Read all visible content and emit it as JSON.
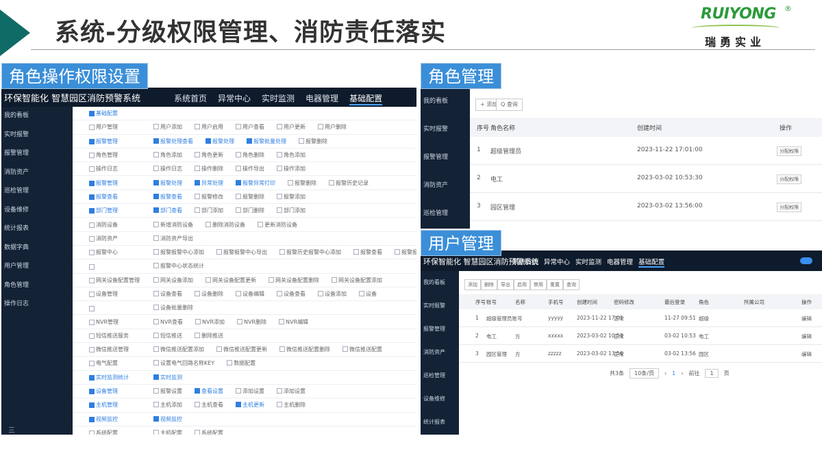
{
  "slide": {
    "title": "系统-分级权限管理、消防责任落实",
    "logo_text": "RUIYONG",
    "logo_reg": "®",
    "logo_cn": "瑞勇实业"
  },
  "labels": {
    "role_perm": "角色操作权限设置",
    "role_mgmt": "角色管理",
    "user_mgmt": "用户管理"
  },
  "p1": {
    "brand": "环保智能化 智慧园区消防预警系统",
    "nav": [
      "系统首页",
      "异常中心",
      "实时监测",
      "电器管理",
      "基础配置"
    ],
    "side": [
      "我的看板",
      "实时报警",
      "报警管理",
      "消防资产",
      "巡检管理",
      "设备维修",
      "统计报表",
      "数据字典",
      "用户管理",
      "角色管理",
      "操作日志"
    ],
    "side_foot": "三",
    "rows": [
      {
        "head": "基础配置",
        "items": [],
        "blue": true
      },
      {
        "head": "用户管理",
        "items": [
          "用户添加",
          "用户启用",
          "用户查看",
          "用户更新",
          "用户删除"
        ]
      },
      {
        "head": "报警管理",
        "items": [
          "报警处理查看",
          "报警处理",
          "报警批量处理",
          "报警删除"
        ],
        "blue": true,
        "on": [
          0,
          1,
          2
        ]
      },
      {
        "head": "角色管理",
        "items": [
          "角色添加",
          "角色更新",
          "角色删除",
          "角色添加"
        ]
      },
      {
        "head": "操作日志",
        "items": [
          "操作日志",
          "操作删除",
          "操作导出",
          "操作添加"
        ]
      },
      {
        "head": "报警管理",
        "items": [
          "报警处理",
          "异常处理",
          "报警异常打印",
          "报警删除",
          "报警历史记录"
        ],
        "blue": true,
        "on": [
          0,
          1,
          2
        ]
      },
      {
        "head": "报警查看",
        "items": [
          "报警查看",
          "报警修改",
          "报警删除",
          "报警添加"
        ],
        "blue": true,
        "on": [
          0
        ]
      },
      {
        "head": "部门管理",
        "items": [
          "部门查看",
          "部门添加",
          "部门删除",
          "部门添加"
        ],
        "blue": true,
        "on": [
          0
        ]
      },
      {
        "head": "消防设备",
        "items": [
          "新增消防设备",
          "删除消防设备",
          "更新消防设备"
        ]
      },
      {
        "head": "消防资产",
        "items": [
          "消防资产导出"
        ]
      },
      {
        "head": "报警中心",
        "items": [
          "报警报警中心添加",
          "报警报警中心导出",
          "报警历史报警中心添加",
          "报警查看",
          "报警报警"
        ]
      },
      {
        "head": "",
        "items": [
          "报警中心状态统计"
        ]
      },
      {
        "head": "网关设备配置管理",
        "items": [
          "网关设备添加",
          "网关设备配置更新",
          "网关设备配置删除",
          "网关设备配置添加"
        ]
      },
      {
        "head": "设备管理",
        "items": [
          "设备查看",
          "设备删除",
          "设备编辑",
          "设备查看",
          "设备添加",
          "设备"
        ]
      },
      {
        "head": "",
        "items": [
          "设备批量删除"
        ]
      },
      {
        "head": "NVR管理",
        "items": [
          "NVR查看",
          "NVR添加",
          "NVR删除",
          "NVR编辑"
        ]
      },
      {
        "head": "短信推送服务",
        "items": [
          "短信推送",
          "删除推送"
        ]
      },
      {
        "head": "微信推送管理",
        "items": [
          "微信推送配置添加",
          "微信推送配置更新",
          "微信推送配置删除",
          "微信推送配置"
        ]
      },
      {
        "head": "电气配置",
        "items": [
          "设置电气回路名称KEY",
          "数据配置"
        ]
      },
      {
        "head": "实时监测统计",
        "items": [
          "实时监测"
        ],
        "blue": true,
        "on": [
          0
        ]
      },
      {
        "head": "设备管理",
        "items": [
          "报警设置",
          "查看设置",
          "添加设置",
          "添加设置"
        ],
        "blue": true,
        "on": [
          1
        ]
      },
      {
        "head": "主机管理",
        "items": [
          "主机添加",
          "主机查看",
          "主机更新",
          "主机删除"
        ],
        "blue": true,
        "on": [
          2
        ]
      },
      {
        "head": "视频监控",
        "items": [
          "视频监控"
        ],
        "blue": true,
        "on": [
          0
        ]
      },
      {
        "head": "系统配置",
        "items": [
          "主机配置",
          "系统配置"
        ]
      }
    ]
  },
  "p2": {
    "side": [
      "我的看板",
      "实时报警",
      "报警管理",
      "消防资产",
      "巡检管理"
    ],
    "btn_add": "+ 添加",
    "btn_search": "Q 查询",
    "headers": [
      "序号",
      "角色名称",
      "创建时间",
      "操作"
    ],
    "rows": [
      {
        "no": "1",
        "name": "超级管理员",
        "time": "2023-11-22 17:01:00",
        "op": "分配权限"
      },
      {
        "no": "2",
        "name": "电工",
        "time": "2023-03-02 10:53:30",
        "op": "分配权限"
      },
      {
        "no": "3",
        "name": "园区管理",
        "time": "2023-03-02 13:56:00",
        "op": "分配权限"
      }
    ]
  },
  "p3": {
    "brand": "环保智能化 智慧园区消防预警系统",
    "nav": [
      "系统首页",
      "异常中心",
      "实时监测",
      "电器管理",
      "基础配置"
    ],
    "side": [
      "我的看板",
      "实时报警",
      "报警管理",
      "消防资产",
      "巡检管理",
      "设备维修",
      "统计报表"
    ],
    "toolbar": [
      "添加",
      "删除",
      "导出",
      "启用",
      "禁用",
      "重置",
      "查询"
    ],
    "headers": [
      "序号",
      "账号",
      "名称",
      "手机号",
      "创建时间",
      "密码修改",
      "最后登录",
      "角色",
      "所属公司",
      "操作"
    ],
    "rows": [
      {
        "no": "1",
        "acct": "超级管理员账号",
        "name": "",
        "phone": "yyyyy",
        "created": "2023-11-22 17:01",
        "pwd": "正常",
        "login": "11-27 09:51",
        "role": "超级",
        "company": "",
        "op": "编辑"
      },
      {
        "no": "2",
        "acct": "电工",
        "name": "方",
        "phone": "xxxxx",
        "created": "2023-03-02 10:53",
        "pwd": "正常",
        "login": "03-02 10:53",
        "role": "电工",
        "company": "",
        "op": "编辑"
      },
      {
        "no": "3",
        "acct": "园区管理",
        "name": "方",
        "phone": "zzzzz",
        "created": "2023-03-02 13:56",
        "pwd": "正常",
        "login": "03-02 13:56",
        "role": "园区",
        "company": "",
        "op": "编辑"
      }
    ],
    "pager": {
      "total": "共3条",
      "size": "10条/页",
      "page": "1",
      "goto": "前往",
      "goto_page": "1",
      "suffix": "页"
    }
  }
}
